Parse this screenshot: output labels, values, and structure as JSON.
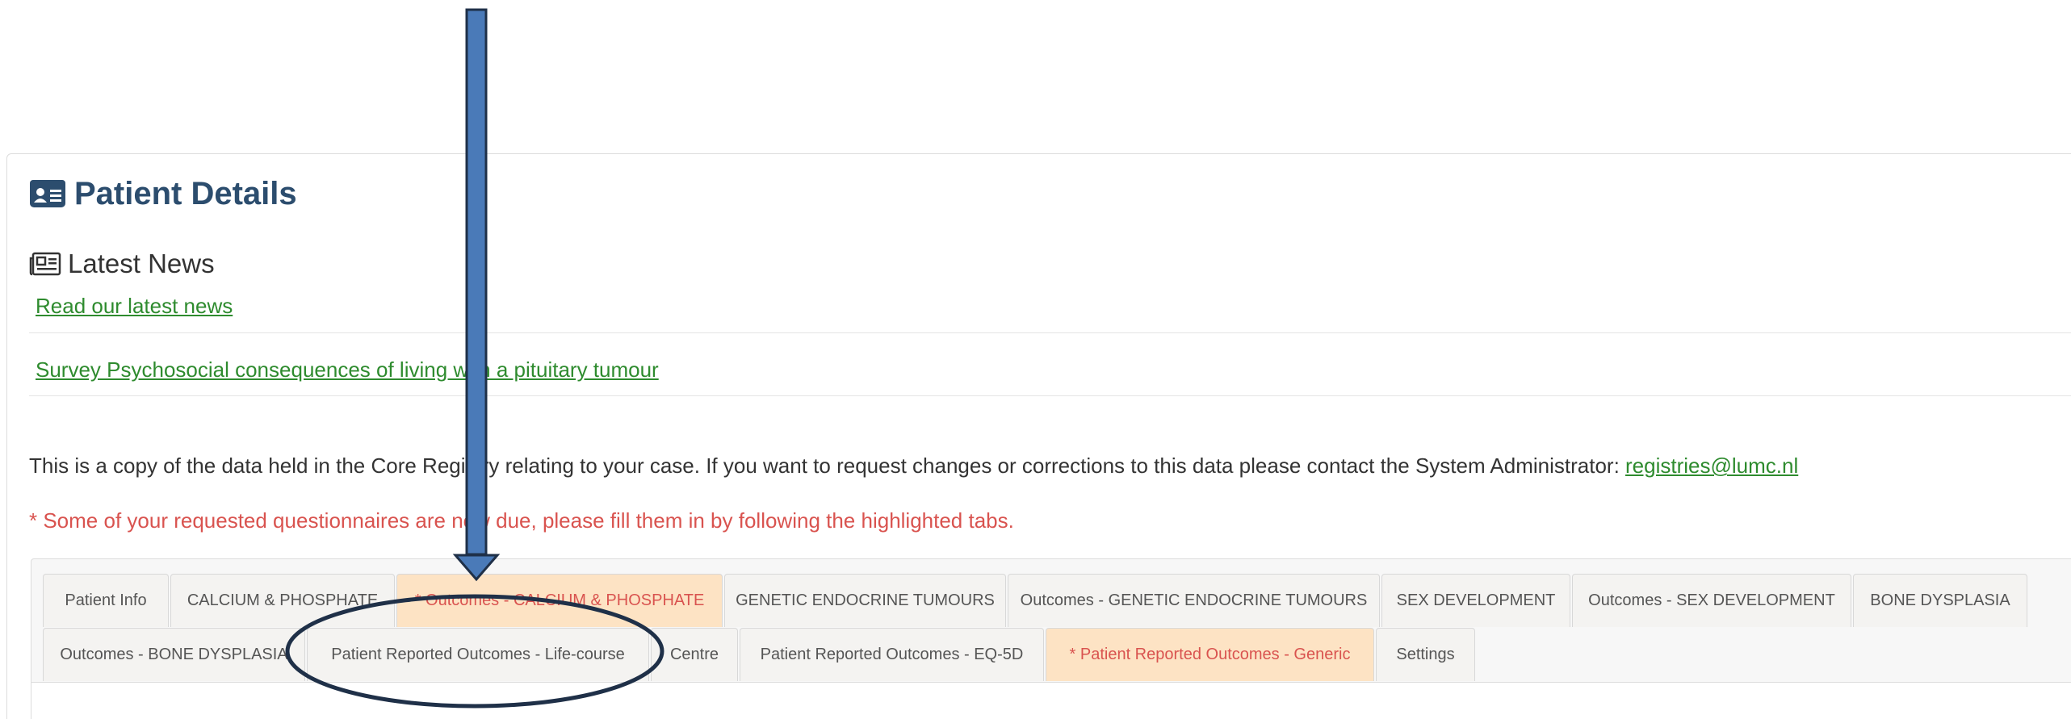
{
  "page": {
    "title": "Patient Details",
    "title_icon": "id-card-icon"
  },
  "news": {
    "heading": "Latest News",
    "heading_icon": "newspaper-icon",
    "links": [
      "Read our latest news",
      "Survey Psychosocial consequences of living with a pituitary tumour"
    ]
  },
  "info": {
    "text": "This is a copy of the data held in the Core Registry relating to your case. If you want to request changes or corrections to this data please contact the System Administrator: ",
    "email": "registries@lumc.nl"
  },
  "alert": {
    "text": "* Some of your requested questionnaires are now due, please fill them in by following the highlighted tabs."
  },
  "tabs": {
    "row1": [
      {
        "label": "Patient Info",
        "highlighted": false
      },
      {
        "label": "CALCIUM & PHOSPHATE",
        "highlighted": false
      },
      {
        "label": "* Outcomes - CALCIUM & PHOSPHATE",
        "highlighted": true
      },
      {
        "label": "GENETIC ENDOCRINE TUMOURS",
        "highlighted": false
      },
      {
        "label": "Outcomes - GENETIC ENDOCRINE TUMOURS",
        "highlighted": false
      },
      {
        "label": "SEX DEVELOPMENT",
        "highlighted": false
      },
      {
        "label": "Outcomes - SEX DEVELOPMENT",
        "highlighted": false
      },
      {
        "label": "BONE DYSPLASIA",
        "highlighted": false
      }
    ],
    "row2": [
      {
        "label": "Outcomes - BONE DYSPLASIA",
        "highlighted": false
      },
      {
        "label": "Patient Reported Outcomes - Life-course",
        "highlighted": false
      },
      {
        "label": "Centre",
        "highlighted": false
      },
      {
        "label": "Patient Reported Outcomes - EQ-5D",
        "highlighted": false
      },
      {
        "label": "* Patient Reported Outcomes - Generic",
        "highlighted": true
      },
      {
        "label": "Settings",
        "highlighted": false
      }
    ]
  },
  "colors": {
    "title": "#2c4d6e",
    "link": "#2e8b2e",
    "alert": "#d9534f",
    "highlight_tab_bg": "#fde3c4",
    "annotation_arrow": "#4a7ab8",
    "annotation_outline": "#1f3048"
  }
}
